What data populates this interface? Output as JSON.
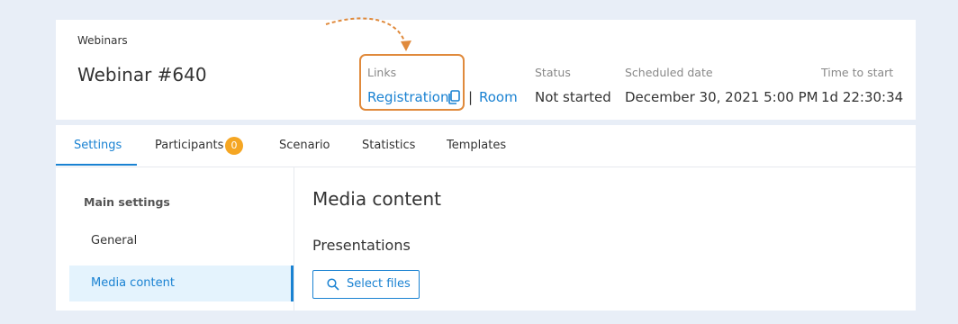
{
  "header": {
    "breadcrumb": "Webinars",
    "title": "Webinar #640",
    "links": {
      "label": "Links",
      "registration": "Registration",
      "separator": "|",
      "room": "Room"
    },
    "status": {
      "label": "Status",
      "value": "Not started"
    },
    "scheduled": {
      "label": "Scheduled date",
      "value": "December 30, 2021 5:00 PM"
    },
    "time_to_start": {
      "label": "Time to start",
      "value": "1d 22:30:34"
    }
  },
  "tabs": [
    {
      "label": "Settings",
      "active": true
    },
    {
      "label": "Participants",
      "badge": "0"
    },
    {
      "label": "Scenario"
    },
    {
      "label": "Statistics"
    },
    {
      "label": "Templates"
    }
  ],
  "sidebar": {
    "section": "Main settings",
    "items": [
      {
        "label": "General"
      },
      {
        "label": "Media content",
        "active": true
      }
    ]
  },
  "content": {
    "title": "Media content",
    "subtitle": "Presentations",
    "select_files": "Select files"
  },
  "colors": {
    "accent": "#1a82d2",
    "highlight": "#e08a3c",
    "badge": "#f5a623",
    "active_bg": "#e4f3fd"
  },
  "icons": {
    "copy": "copy-icon",
    "search": "search-icon",
    "arrow": "dashed-arrow"
  }
}
